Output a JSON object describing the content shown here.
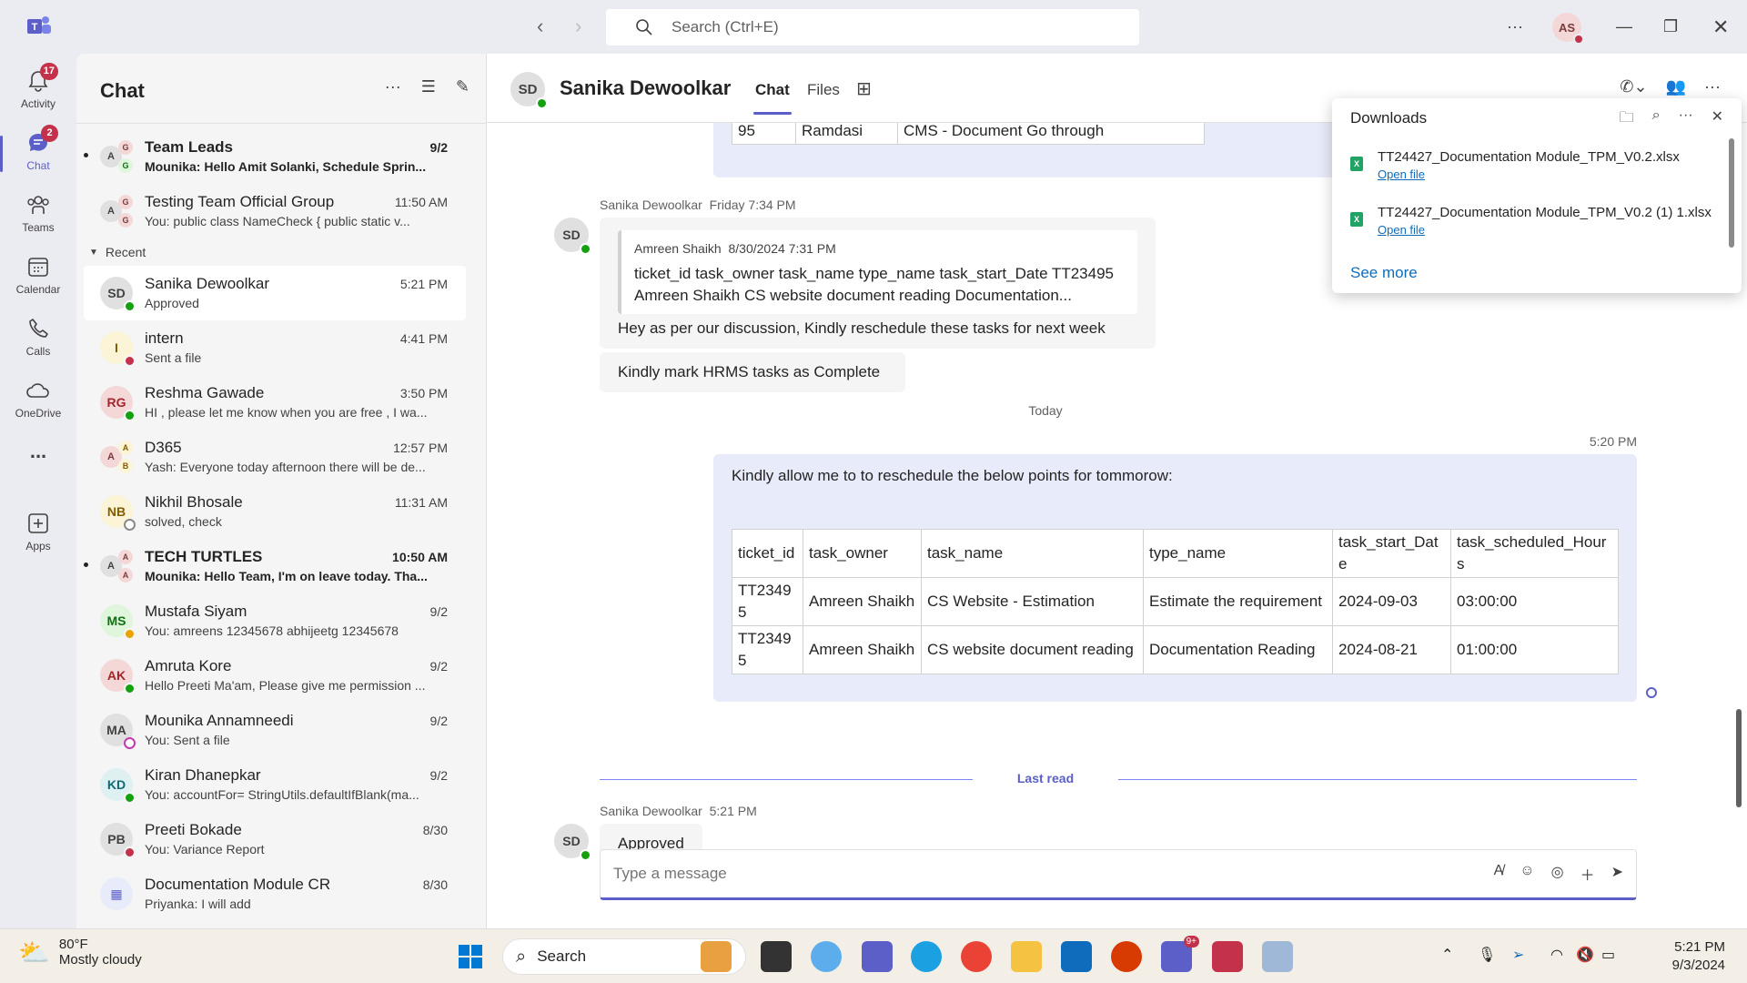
{
  "titlebar": {
    "search_placeholder": "Search (Ctrl+E)",
    "user_initials": "AS"
  },
  "rail": [
    {
      "label": "Activity",
      "badge": "17"
    },
    {
      "label": "Chat",
      "badge": "2"
    },
    {
      "label": "Teams"
    },
    {
      "label": "Calendar"
    },
    {
      "label": "Calls"
    },
    {
      "label": "OneDrive"
    },
    {
      "label": "..."
    },
    {
      "label": "Apps"
    }
  ],
  "chatlist": {
    "title": "Chat",
    "recent_label": "Recent",
    "pinned": [
      {
        "name": "Team Leads",
        "time": "9/2",
        "preview": "Mounika: Hello Amit Solanki,   Schedule Sprin...",
        "unread": true
      },
      {
        "name": "Testing Team Official Group",
        "time": "11:50 AM",
        "preview": "You: public class NameCheck {      public static v..."
      }
    ],
    "recent": [
      {
        "name": "Sanika Dewoolkar",
        "time": "5:21 PM",
        "preview": "Approved",
        "initials": "SD"
      },
      {
        "name": "intern",
        "time": "4:41 PM",
        "preview": "Sent a file",
        "initials": "I"
      },
      {
        "name": "Reshma Gawade",
        "time": "3:50 PM",
        "preview": "HI , please let me know when you are free , I wa...",
        "initials": "RG"
      },
      {
        "name": "D365",
        "time": "12:57 PM",
        "preview": "Yash: Everyone today afternoon there will be de...",
        "initials": "A"
      },
      {
        "name": "Nikhil Bhosale",
        "time": "11:31 AM",
        "preview": "solved, check",
        "initials": "NB"
      },
      {
        "name": "TECH TURTLES",
        "time": "10:50 AM",
        "preview": "Mounika: Hello Team, I'm on leave today. Tha...",
        "initials": "A",
        "unread": true
      },
      {
        "name": "Mustafa Siyam",
        "time": "9/2",
        "preview": "You: amreens 12345678 abhijeetg 12345678",
        "initials": "MS"
      },
      {
        "name": "Amruta Kore",
        "time": "9/2",
        "preview": "Hello Preeti Ma'am, Please give me permission ...",
        "initials": "AK"
      },
      {
        "name": "Mounika Annamneedi",
        "time": "9/2",
        "preview": "You: Sent a file",
        "initials": "MA"
      },
      {
        "name": "Kiran Dhanepkar",
        "time": "9/2",
        "preview": "You: accountFor=  StringUtils.defaultIfBlank(ma...",
        "initials": "KD"
      },
      {
        "name": "Preeti Bokade",
        "time": "8/30",
        "preview": "You: Variance Report",
        "initials": "PB"
      },
      {
        "name": "Documentation Module CR",
        "time": "8/30",
        "preview": "Priyanka: I will add",
        "initials": ""
      }
    ]
  },
  "main": {
    "contact_name": "Sanika Dewoolkar",
    "contact_initials": "SD",
    "tabs": [
      "Chat",
      "Files"
    ],
    "top_table_partial": {
      "c1": "95",
      "c2": "Ramdasi",
      "c3": "CMS - Document Go through"
    },
    "msg1": {
      "sender": "Sanika Dewoolkar",
      "time": "Friday 7:34 PM",
      "quote_header_name": "Amreen Shaikh",
      "quote_header_time": "8/30/2024 7:31 PM",
      "quote_line1": "ticket_id task_owner task_name type_name task_start_Date TT23495",
      "quote_line2": "Amreen Shaikh CS website document reading Documentation...",
      "text": "Hey as per our discussion, Kindly reschedule these tasks for next week"
    },
    "msg2": {
      "text": "Kindly mark  HRMS tasks as Complete"
    },
    "day_divider": "Today",
    "my_msg": {
      "time": "5:20 PM",
      "text": "Kindly allow me to to reschedule the below points for tommorow:",
      "table": {
        "headers": [
          "ticket_id",
          "task_owner",
          "task_name",
          "type_name",
          "task_start_Date",
          "task_scheduled_Hours"
        ],
        "rows": [
          [
            "TT23495",
            "Amreen Shaikh",
            "CS Website - Estimation",
            "Estimate the requirement",
            "2024-09-03",
            "03:00:00"
          ],
          [
            "TT23495",
            "Amreen Shaikh",
            "CS website document reading",
            "Documentation Reading",
            "2024-08-21",
            "01:00:00"
          ]
        ]
      }
    },
    "last_read": "Last read",
    "msg3": {
      "sender": "Sanika Dewoolkar",
      "time": "5:21 PM",
      "text": "Approved"
    },
    "composer_placeholder": "Type a message"
  },
  "downloads": {
    "title": "Downloads",
    "files": [
      {
        "name": "TT24427_Documentation Module_TPM_V0.2.xlsx",
        "action": "Open file"
      },
      {
        "name": "TT24427_Documentation Module_TPM_V0.2 (1) 1.xlsx",
        "action": "Open file"
      }
    ],
    "see_more": "See more"
  },
  "taskbar": {
    "temp": "80°F",
    "weather": "Mostly cloudy",
    "search": "Search",
    "time": "5:21 PM",
    "date": "9/3/2024",
    "teams_badge": "9+"
  }
}
